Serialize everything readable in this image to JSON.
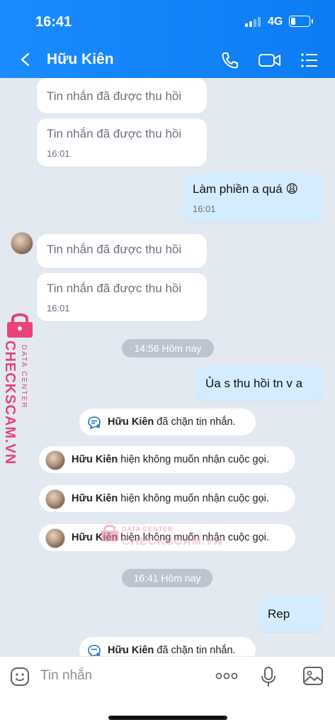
{
  "status_bar": {
    "time": "16:41",
    "network": "4G"
  },
  "header": {
    "contact_name": "Hữu Kiên"
  },
  "messages": [
    {
      "text": "Tin nhắn đã được thu hồi",
      "time": ""
    },
    {
      "text": "Tin nhắn đã được thu hồi",
      "time": "16:01"
    },
    {
      "text": "Làm phiền a quá 😩",
      "time": "16:01"
    },
    {
      "text": "Tin nhắn đã được thu hồi",
      "time": ""
    },
    {
      "text": "Tin nhắn đã được thu hồi",
      "time": "16:01"
    },
    {
      "text": "Ủa s thu hồi tn v a",
      "time": ""
    },
    {
      "text": "Rep",
      "time": ""
    }
  ],
  "time_separators": [
    "14:56 Hôm nay",
    "16:41 Hôm nay"
  ],
  "system_notes": [
    {
      "name": "Hữu Kiên",
      "text": " đã chặn tin nhắn."
    },
    {
      "name": "Hữu Kiên",
      "text": " hiện không muốn nhận cuộc gọi."
    },
    {
      "name": "Hữu Kiên",
      "text": " hiện không muốn nhận cuộc gọi."
    },
    {
      "name": "Hữu Kiên",
      "text": " hiện không muốn nhận cuộc gọi."
    },
    {
      "name": "Hữu Kiên",
      "text": " đã chặn tin nhắn."
    }
  ],
  "input": {
    "placeholder": "Tin nhắn"
  },
  "watermark": {
    "brand": "CHECKSCAM.VN",
    "tagline": "DATA CENTER",
    "brand_center": "CHECKSCAM.VN"
  },
  "colors": {
    "header": "#0c7cf2",
    "my_bubble": "#d4ecfd",
    "chat_bg": "#e2e9f1",
    "watermark": "#e8447a"
  }
}
